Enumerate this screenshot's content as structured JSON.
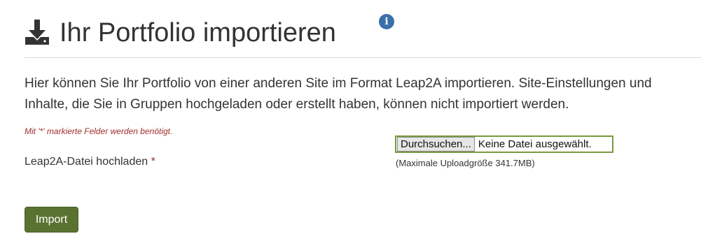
{
  "header": {
    "icon": "download-icon",
    "title": "Ihr Portfolio importieren",
    "info_icon": "info-icon",
    "info_glyph": "i"
  },
  "intro": {
    "text": "Hier können Sie Ihr Portfolio von einer anderen Site im Format Leap2A importieren. Site-Einstellungen und Inhalte, die Sie in Gruppen hochgeladen oder erstellt haben, können nicht importiert werden."
  },
  "form": {
    "required_note": "Mit '*' markierte Felder werden benötigt.",
    "file_field": {
      "label": "Leap2A-Datei hochladen",
      "required_marker": "*",
      "browse_label": "Durchsuchen...",
      "status": "Keine Datei ausgewählt.",
      "hint": "(Maximale Uploadgröße 341.7MB)"
    },
    "submit_label": "Import"
  },
  "colors": {
    "accent": "#5a7231",
    "required": "#a12d2d",
    "info": "#3b6faa",
    "focus_border": "#7a9a3b"
  }
}
